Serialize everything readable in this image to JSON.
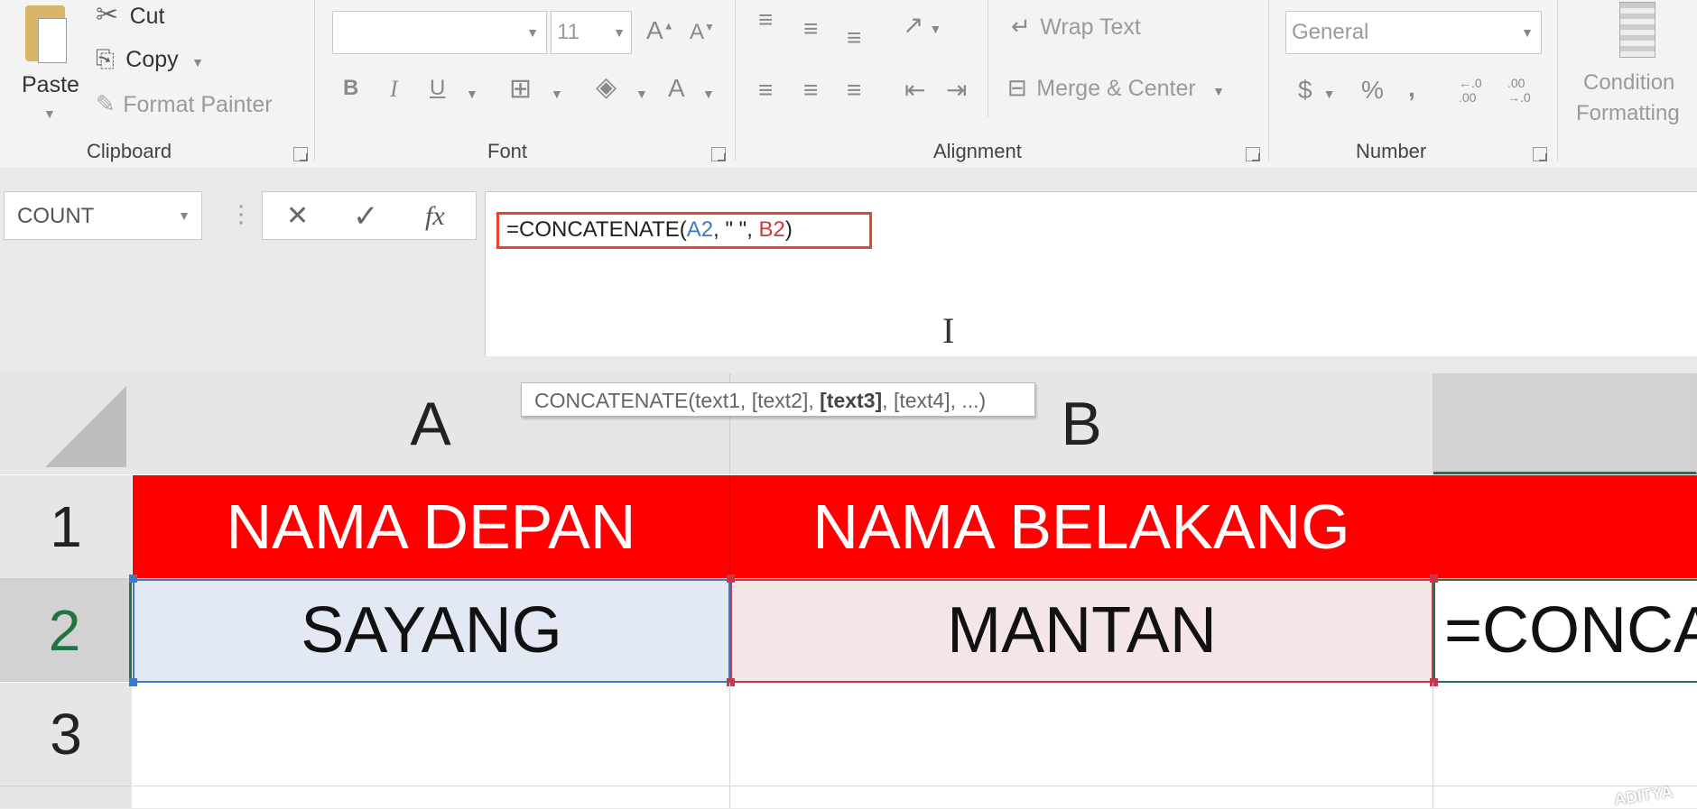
{
  "clipboard": {
    "paste_label": "Paste",
    "cut_label": "Cut",
    "copy_label": "Copy",
    "format_painter_label": "Format Painter",
    "group_label": "Clipboard"
  },
  "font": {
    "font_name": "",
    "font_size": "11",
    "bold_label": "B",
    "italic_label": "I",
    "underline_label": "U",
    "grow_label": "A",
    "shrink_label": "A",
    "font_color_label": "A",
    "group_label": "Font"
  },
  "alignment": {
    "wrap_text_label": "Wrap Text",
    "merge_center_label": "Merge & Center",
    "group_label": "Alignment"
  },
  "number": {
    "format_value": "General",
    "currency_label": "$",
    "percent_label": "%",
    "comma_label": ",",
    "increase_decimal_label": "←.0\n.00",
    "decrease_decimal_label": ".00\n→.0",
    "group_label": "Number"
  },
  "styles": {
    "conditional_line1": "Condition",
    "conditional_line2": "Formatting"
  },
  "formula_bar": {
    "name_box": "COUNT",
    "formula_prefix": "=CONCATENATE(",
    "arg1": "A2",
    "arg_sep1": ", \" \", ",
    "arg3": "B2",
    "formula_suffix": ")",
    "cancel_icon": "✕",
    "enter_icon": "✓",
    "fx_label": "fx"
  },
  "tooltip": {
    "func": "CONCATENATE(",
    "arg1": "text1",
    "sep1": ", ",
    "arg2": "[text2]",
    "sep2": ", ",
    "arg3": "[text3]",
    "sep3": ", ",
    "arg4": "[text4]",
    "rest": ", ...)"
  },
  "sheet": {
    "columns": [
      "A",
      "B"
    ],
    "rows": [
      "1",
      "2",
      "3"
    ],
    "a1": "NAMA DEPAN",
    "b1": "NAMA BELAKANG",
    "a2": "SAYANG",
    "b2": "MANTAN",
    "c2": "=CONCA",
    "header_color": "#ff0000"
  },
  "watermark": "ADITYA"
}
